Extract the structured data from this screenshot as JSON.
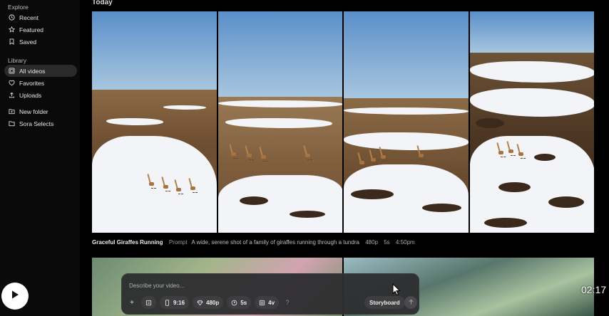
{
  "sidebar": {
    "explore_title": "Explore",
    "explore_items": [
      {
        "label": "Recent",
        "icon": "clock-icon"
      },
      {
        "label": "Featured",
        "icon": "star-icon"
      },
      {
        "label": "Saved",
        "icon": "bookmark-icon"
      }
    ],
    "library_title": "Library",
    "library_items": [
      {
        "label": "All videos",
        "icon": "grid-icon",
        "active": true
      },
      {
        "label": "Favorites",
        "icon": "heart-icon"
      },
      {
        "label": "Uploads",
        "icon": "upload-icon"
      }
    ],
    "folder_items": [
      {
        "label": "New folder",
        "icon": "folder-plus-icon"
      },
      {
        "label": "Sora Selects",
        "icon": "folder-icon"
      }
    ]
  },
  "main": {
    "day_title": "Today",
    "caption": {
      "title": "Graceful Giraffes Running",
      "prompt_label": "Prompt",
      "prompt": "A wide, serene shot of a family of giraffes running through a tundra",
      "resolution": "480p",
      "duration": "5s",
      "time": "4:50pm"
    }
  },
  "composer": {
    "placeholder": "Describe your video...",
    "add": "+",
    "aspect": "9:16",
    "quality": "480p",
    "duration": "5s",
    "variations": "4v",
    "help": "?",
    "storyboard": "Storyboard"
  },
  "overlay": {
    "timestamp": "02:17"
  },
  "colors": {
    "background": "#000000",
    "sidebar": "#0a0a0a",
    "active_item": "#2a2a2a",
    "composer": "#2e2e30",
    "chip": "#3e3e40"
  }
}
